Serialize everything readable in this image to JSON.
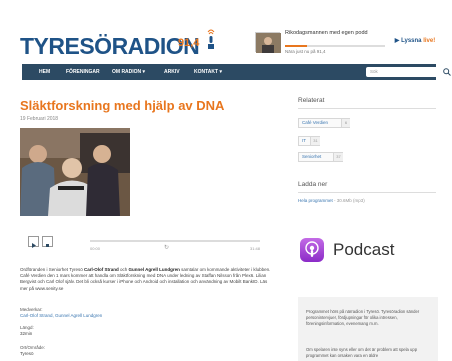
{
  "brand": {
    "logo_text": "TYRESÖRADION",
    "frequency": "91,4",
    "logo_color": "#1f5387",
    "accent_color": "#e8761e"
  },
  "now_playing": {
    "title": "Rikodagsmannen med egen podd",
    "subtitle": "Nära just nu på 91,4",
    "progress_fraction": 0.22
  },
  "listen_button": {
    "label": "Lyssna",
    "live_label": "live!"
  },
  "nav": {
    "items": [
      "HEM",
      "FÖRENINGAR",
      "OM RADION ▾",
      "ARKIV",
      "KONTAKT ▾"
    ],
    "search_placeholder": "Sök"
  },
  "article": {
    "title": "Släktforskning med hjälp av DNA",
    "date": "19 Februari 2018",
    "player": {
      "elapsed": "00:00",
      "duration": "31:48"
    },
    "description_lead": "Ordföranden i Seniorhet Tyresö ",
    "description_person1": "Carl-Olof Strand",
    "description_mid": " och ",
    "description_person2": "Gunnel Agrell Lundgren",
    "description_rest": " samtalar om kommande aktiviteter i klubben. Café Verdien den 1 mars kommer att handla om Släktforskning med DNA under ledning av Staffan Nilsson från Plex6. Lilian Bergvist och Carl Olof själv. Det bli också kurser i iPhone och Android och installation och användning av Mobilt BankID. Läs mer på www.senity.se",
    "participants_label": "Medverkar:",
    "participants_value": "Carl-Olof Strand, Gunnel Agrell Lundgren",
    "length_label": "Längd:",
    "length_value": "32min",
    "area_label": "Ort/Område:",
    "area_value": "Tyresö"
  },
  "sidebar": {
    "related_heading": "Relaterat",
    "tags": [
      {
        "label": "Café Verdien",
        "count": "6"
      },
      {
        "label": "IT",
        "count": "31"
      },
      {
        "label": "Seniorhet",
        "count": "37"
      }
    ],
    "download_heading": "Ladda ner",
    "download_link": "Hela programmet",
    "download_size": "- 30.6Mb (mp3)",
    "podcast_label": "Podcast",
    "info_text_1": "Programmet hörs på närradion i Tyresö. Tyresöradion sänder personintervjuer, fördjupningar för olika intressen, föreningsinformation, evenemang m.m.",
    "info_text_2": "Om spelaren inte syns eller om det är problem att spela upp programmet kan orsaken vara en äldre"
  }
}
